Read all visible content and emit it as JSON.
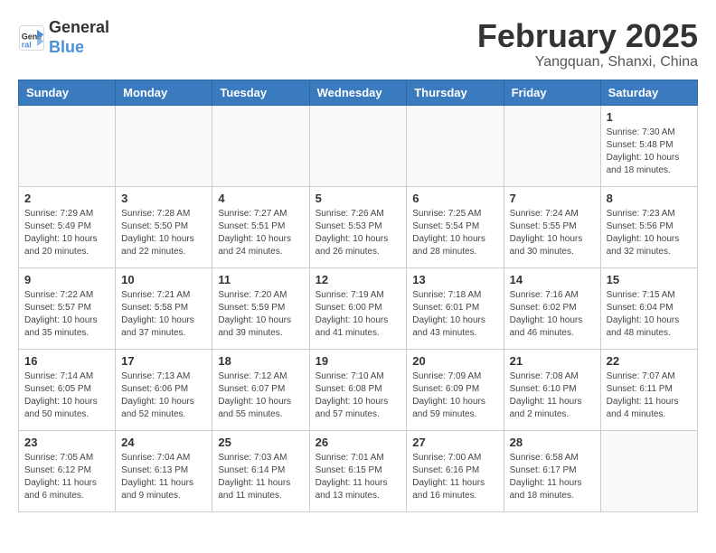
{
  "header": {
    "logo_line1": "General",
    "logo_line2": "Blue",
    "month": "February 2025",
    "location": "Yangquan, Shanxi, China"
  },
  "days_of_week": [
    "Sunday",
    "Monday",
    "Tuesday",
    "Wednesday",
    "Thursday",
    "Friday",
    "Saturday"
  ],
  "weeks": [
    [
      {
        "day": "",
        "info": ""
      },
      {
        "day": "",
        "info": ""
      },
      {
        "day": "",
        "info": ""
      },
      {
        "day": "",
        "info": ""
      },
      {
        "day": "",
        "info": ""
      },
      {
        "day": "",
        "info": ""
      },
      {
        "day": "1",
        "info": "Sunrise: 7:30 AM\nSunset: 5:48 PM\nDaylight: 10 hours and 18 minutes."
      }
    ],
    [
      {
        "day": "2",
        "info": "Sunrise: 7:29 AM\nSunset: 5:49 PM\nDaylight: 10 hours and 20 minutes."
      },
      {
        "day": "3",
        "info": "Sunrise: 7:28 AM\nSunset: 5:50 PM\nDaylight: 10 hours and 22 minutes."
      },
      {
        "day": "4",
        "info": "Sunrise: 7:27 AM\nSunset: 5:51 PM\nDaylight: 10 hours and 24 minutes."
      },
      {
        "day": "5",
        "info": "Sunrise: 7:26 AM\nSunset: 5:53 PM\nDaylight: 10 hours and 26 minutes."
      },
      {
        "day": "6",
        "info": "Sunrise: 7:25 AM\nSunset: 5:54 PM\nDaylight: 10 hours and 28 minutes."
      },
      {
        "day": "7",
        "info": "Sunrise: 7:24 AM\nSunset: 5:55 PM\nDaylight: 10 hours and 30 minutes."
      },
      {
        "day": "8",
        "info": "Sunrise: 7:23 AM\nSunset: 5:56 PM\nDaylight: 10 hours and 32 minutes."
      }
    ],
    [
      {
        "day": "9",
        "info": "Sunrise: 7:22 AM\nSunset: 5:57 PM\nDaylight: 10 hours and 35 minutes."
      },
      {
        "day": "10",
        "info": "Sunrise: 7:21 AM\nSunset: 5:58 PM\nDaylight: 10 hours and 37 minutes."
      },
      {
        "day": "11",
        "info": "Sunrise: 7:20 AM\nSunset: 5:59 PM\nDaylight: 10 hours and 39 minutes."
      },
      {
        "day": "12",
        "info": "Sunrise: 7:19 AM\nSunset: 6:00 PM\nDaylight: 10 hours and 41 minutes."
      },
      {
        "day": "13",
        "info": "Sunrise: 7:18 AM\nSunset: 6:01 PM\nDaylight: 10 hours and 43 minutes."
      },
      {
        "day": "14",
        "info": "Sunrise: 7:16 AM\nSunset: 6:02 PM\nDaylight: 10 hours and 46 minutes."
      },
      {
        "day": "15",
        "info": "Sunrise: 7:15 AM\nSunset: 6:04 PM\nDaylight: 10 hours and 48 minutes."
      }
    ],
    [
      {
        "day": "16",
        "info": "Sunrise: 7:14 AM\nSunset: 6:05 PM\nDaylight: 10 hours and 50 minutes."
      },
      {
        "day": "17",
        "info": "Sunrise: 7:13 AM\nSunset: 6:06 PM\nDaylight: 10 hours and 52 minutes."
      },
      {
        "day": "18",
        "info": "Sunrise: 7:12 AM\nSunset: 6:07 PM\nDaylight: 10 hours and 55 minutes."
      },
      {
        "day": "19",
        "info": "Sunrise: 7:10 AM\nSunset: 6:08 PM\nDaylight: 10 hours and 57 minutes."
      },
      {
        "day": "20",
        "info": "Sunrise: 7:09 AM\nSunset: 6:09 PM\nDaylight: 10 hours and 59 minutes."
      },
      {
        "day": "21",
        "info": "Sunrise: 7:08 AM\nSunset: 6:10 PM\nDaylight: 11 hours and 2 minutes."
      },
      {
        "day": "22",
        "info": "Sunrise: 7:07 AM\nSunset: 6:11 PM\nDaylight: 11 hours and 4 minutes."
      }
    ],
    [
      {
        "day": "23",
        "info": "Sunrise: 7:05 AM\nSunset: 6:12 PM\nDaylight: 11 hours and 6 minutes."
      },
      {
        "day": "24",
        "info": "Sunrise: 7:04 AM\nSunset: 6:13 PM\nDaylight: 11 hours and 9 minutes."
      },
      {
        "day": "25",
        "info": "Sunrise: 7:03 AM\nSunset: 6:14 PM\nDaylight: 11 hours and 11 minutes."
      },
      {
        "day": "26",
        "info": "Sunrise: 7:01 AM\nSunset: 6:15 PM\nDaylight: 11 hours and 13 minutes."
      },
      {
        "day": "27",
        "info": "Sunrise: 7:00 AM\nSunset: 6:16 PM\nDaylight: 11 hours and 16 minutes."
      },
      {
        "day": "28",
        "info": "Sunrise: 6:58 AM\nSunset: 6:17 PM\nDaylight: 11 hours and 18 minutes."
      },
      {
        "day": "",
        "info": ""
      }
    ]
  ]
}
